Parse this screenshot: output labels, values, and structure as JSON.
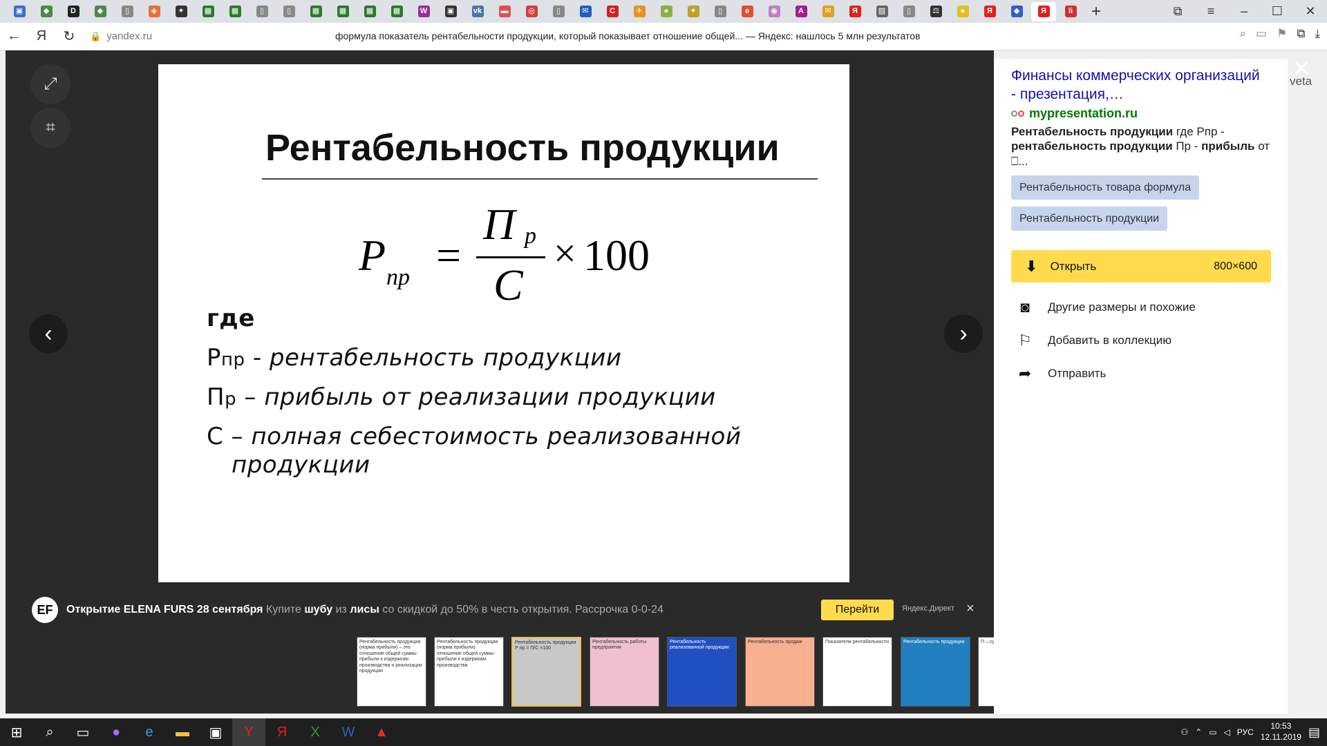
{
  "tabs": [
    {
      "icon": "window-icon",
      "glyph": "▣",
      "bg": "#3b6bd6"
    },
    {
      "icon": "arrow-icon",
      "glyph": "◆",
      "bg": "#4a8a4a"
    },
    {
      "icon": "d-icon",
      "glyph": "D",
      "bg": "#222"
    },
    {
      "icon": "arrow-icon",
      "glyph": "◆",
      "bg": "#4a8a4a"
    },
    {
      "icon": "doc-icon",
      "glyph": "▯",
      "bg": "#888"
    },
    {
      "icon": "orange-icon",
      "glyph": "◈",
      "bg": "#e8703a"
    },
    {
      "icon": "star-icon",
      "glyph": "✦",
      "bg": "#333"
    },
    {
      "icon": "grid-icon",
      "glyph": "▦",
      "bg": "#2a7a2a"
    },
    {
      "icon": "grid-icon",
      "glyph": "▦",
      "bg": "#2a7a2a"
    },
    {
      "icon": "doc-icon",
      "glyph": "▯",
      "bg": "#888"
    },
    {
      "icon": "doc-icon",
      "glyph": "▯",
      "bg": "#888"
    },
    {
      "icon": "grid-icon",
      "glyph": "▦",
      "bg": "#2a7a2a"
    },
    {
      "icon": "grid-icon",
      "glyph": "▦",
      "bg": "#2a7a2a"
    },
    {
      "icon": "grid-icon",
      "glyph": "▦",
      "bg": "#2a7a2a"
    },
    {
      "icon": "grid-icon",
      "glyph": "▦",
      "bg": "#2a7a2a"
    },
    {
      "icon": "w-icon",
      "glyph": "W",
      "bg": "#9b2d9b"
    },
    {
      "icon": "train-icon",
      "glyph": "▣",
      "bg": "#333"
    },
    {
      "icon": "vk-icon",
      "glyph": "vk",
      "bg": "#4a76a8"
    },
    {
      "icon": "pill-icon",
      "glyph": "▬",
      "bg": "#e05050"
    },
    {
      "icon": "target-icon",
      "glyph": "◎",
      "bg": "#d04040"
    },
    {
      "icon": "doc-icon",
      "glyph": "▯",
      "bg": "#888"
    },
    {
      "icon": "mail-icon",
      "glyph": "✉",
      "bg": "#2060c0"
    },
    {
      "icon": "c-icon",
      "glyph": "C",
      "bg": "#d02020"
    },
    {
      "icon": "bird-icon",
      "glyph": "✈",
      "bg": "#e89020"
    },
    {
      "icon": "globe-icon",
      "glyph": "●",
      "bg": "#8ab040"
    },
    {
      "icon": "star-icon",
      "glyph": "✦",
      "bg": "#c0a030"
    },
    {
      "icon": "doc-icon",
      "glyph": "▯",
      "bg": "#888"
    },
    {
      "icon": "e-icon",
      "glyph": "e",
      "bg": "#e05030"
    },
    {
      "icon": "pin-icon",
      "glyph": "◉",
      "bg": "#c080c0"
    },
    {
      "icon": "a-icon",
      "glyph": "A",
      "bg": "#a02090"
    },
    {
      "icon": "mail-icon",
      "glyph": "✉",
      "bg": "#e0a020"
    },
    {
      "icon": "ya-icon",
      "glyph": "Я",
      "bg": "#e02020"
    },
    {
      "icon": "image-icon",
      "glyph": "▨",
      "bg": "#666"
    },
    {
      "icon": "doc-icon",
      "glyph": "▯",
      "bg": "#888"
    },
    {
      "icon": "scales-icon",
      "glyph": "⚖",
      "bg": "#333"
    },
    {
      "icon": "coin-icon",
      "glyph": "●",
      "bg": "#e0c020"
    },
    {
      "icon": "ya-icon",
      "glyph": "Я",
      "bg": "#e02020"
    },
    {
      "icon": "shield-icon",
      "glyph": "◆",
      "bg": "#3060c0"
    },
    {
      "icon": "ya-icon",
      "glyph": "Я",
      "bg": "#e02020",
      "active": true
    },
    {
      "icon": "list-icon",
      "glyph": "li",
      "bg": "#d03030"
    }
  ],
  "address": {
    "domain": "yandex.ru",
    "title": "формула показатель рентабельности продукции, который показывает отношение общей... — Яндекс: нашлось 5 млн результатов"
  },
  "slide": {
    "title": "Рентабельность продукции",
    "formula": {
      "lhs": "P",
      "lhs_sub": "пр",
      "eq": "=",
      "num": "П",
      "num_sub": "р",
      "den": "C",
      "times": "×",
      "factor": "100"
    },
    "where": "где",
    "lines": [
      {
        "sym": "Р",
        "sub": "пр",
        "dash": " - ",
        "text": "рентабельность продукции"
      },
      {
        "sym": "П",
        "sub": "р",
        "dash": " – ",
        "text": "прибыль от реализации продукции"
      },
      {
        "sym": "С",
        "sub": "",
        "dash": " – ",
        "text": "полная себестоимость реализованной"
      }
    ],
    "line_cont": "продукции"
  },
  "ad": {
    "logo": "EF",
    "bold1": "Открытие ELENA FURS 28 сентября",
    "t1": " Купите ",
    "bold2": "шубу",
    "t2": " из ",
    "bold3": "лисы",
    "t3": " со скидкой до 50% в честь открытия. Рассрочка 0-0-24",
    "button": "Перейти",
    "direct": "Яндекс.Директ",
    "close": "×"
  },
  "thumbs": [
    {
      "text": "Рентабельность продукции (норма прибыли) – это отношение общей суммы прибыли к издержкам производства и реализации продукции",
      "bg": "#ffffff"
    },
    {
      "text": "Рентабельность продукции (норма прибыли) отношение общей суммы прибыли к издержкам производства",
      "bg": "#ffffff"
    },
    {
      "text": "Рентабельность продукции Р пр = П/С ×100",
      "bg": "#c8c8c8"
    },
    {
      "text": "Рентабельность работы предприятия",
      "bg": "#f0c0d0"
    },
    {
      "text": "Рентабельность реализованной продукции",
      "bg": "#2050c0"
    },
    {
      "text": "Рентабельность продаж",
      "bg": "#f8b090"
    },
    {
      "text": "Показатели рентабельности",
      "bg": "#ffffff"
    },
    {
      "text": "Рентабельность продукции",
      "bg": "#2080c0"
    },
    {
      "text": "П – сумма",
      "bg": "#ffffff"
    }
  ],
  "side": {
    "title": "Финансы коммерческих организаций - презентация,…",
    "domain": "mypresentation.ru",
    "snip_b1": "Рентабельность продукции",
    "snip_t1": " где Рпр - ",
    "snip_b2": "рентабельность продукции",
    "snip_t2": " Пр - ",
    "snip_b3": "прибыль",
    "snip_t3": " от ⎕...",
    "chips": [
      "Рентабельность товара формула",
      "Рентабельность продукции"
    ],
    "open_label": "Открыть",
    "open_size": "800×600",
    "actions": [
      {
        "icon": "camera-icon",
        "glyph": "📷",
        "label": "Другие размеры и похожие"
      },
      {
        "icon": "bookmark-icon",
        "glyph": "🔖",
        "label": "Добавить в коллекцию"
      },
      {
        "icon": "share-icon",
        "glyph": "➦",
        "label": "Отправить"
      }
    ],
    "peek": "veta"
  },
  "taskbar": {
    "lang": "РУС",
    "time": "10:53",
    "date": "12.11.2019"
  }
}
